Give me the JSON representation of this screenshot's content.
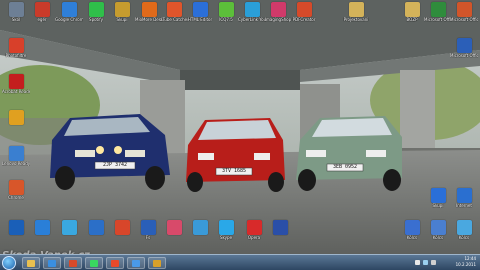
{
  "desktop_icons": [
    {
      "label": "Skól",
      "color": "#6d7f95",
      "icon": "computer-icon"
    },
    {
      "label": "egér",
      "color": "#c93b2a",
      "icon": "app-icon"
    },
    {
      "label": "Google Chrome",
      "color": "#2f7fd8",
      "icon": "chrome-icon"
    },
    {
      "label": "Spotify",
      "color": "#2fbf4a",
      "icon": "app-icon"
    },
    {
      "label": "Skupi",
      "color": "#c69c2e",
      "icon": "folder-icon"
    },
    {
      "label": "MioMore Desktop",
      "color": "#e06a1a",
      "icon": "app-icon"
    },
    {
      "label": "aTube Catcher",
      "color": "#e0552b",
      "icon": "app-icon"
    },
    {
      "label": "HTML Editor",
      "color": "#2b6fd8",
      "icon": "app-icon"
    },
    {
      "label": "ICQ7.5",
      "color": "#5cbf3a",
      "icon": "icq-icon"
    },
    {
      "label": "CyberLink YouCam",
      "color": "#2a9fd8",
      "icon": "webcam-icon"
    },
    {
      "label": "ImagingShop",
      "color": "#d13a6a",
      "icon": "app-icon"
    },
    {
      "label": "PDFCreator",
      "color": "#d64a2a",
      "icon": "pdf-icon"
    },
    {
      "label": "Projektovani",
      "color": "#d4b35a",
      "icon": "folder-icon"
    },
    {
      "label": "BOZP",
      "color": "#d4b35a",
      "icon": "folder-icon"
    },
    {
      "label": "Microsoft Office Ex...",
      "color": "#2f8c3c",
      "icon": "excel-icon"
    },
    {
      "label": "Microsoft Office P...",
      "color": "#d1552a",
      "icon": "powerpoint-icon"
    },
    {
      "label": "Photofiltre",
      "color": "#d8402a",
      "icon": "app-icon"
    },
    {
      "label": "Microsoft Office W...",
      "color": "#2b5fb8",
      "icon": "word-icon"
    },
    {
      "label": "Acrobat Reader",
      "color": "#c41e1e",
      "icon": "acrobat-icon"
    },
    {
      "label": "",
      "color": "#e0a020",
      "icon": "app-icon"
    },
    {
      "label": "Lenovo ReadyComm",
      "color": "#3a7fd0",
      "icon": "app-icon"
    },
    {
      "label": "Chrome",
      "color": "#d8562a",
      "icon": "app-icon"
    },
    {
      "label": "",
      "color": "#1a5fb8",
      "icon": "app-icon"
    },
    {
      "label": "",
      "color": "#2a7fd8",
      "icon": "app-icon"
    },
    {
      "label": "",
      "color": "#3aa8e0",
      "icon": "app-icon"
    },
    {
      "label": "",
      "color": "#2b6fc8",
      "icon": "app-icon"
    },
    {
      "label": "",
      "color": "#d8462a",
      "icon": "app-icon"
    },
    {
      "label": "Fs",
      "color": "#2a5fb8",
      "icon": "app-icon"
    },
    {
      "label": "",
      "color": "#d84a6a",
      "icon": "app-icon"
    },
    {
      "label": "",
      "color": "#3a9ad8",
      "icon": "app-icon"
    },
    {
      "label": "Skype",
      "color": "#2aa8e8",
      "icon": "skype-icon"
    },
    {
      "label": "Opera",
      "color": "#d82a2a",
      "icon": "opera-icon"
    },
    {
      "label": "",
      "color": "#2a4fa8",
      "icon": "app-icon"
    },
    {
      "label": "Kölcs",
      "color": "#3a6fd0",
      "icon": "app-icon"
    },
    {
      "label": "Kölcs",
      "color": "#4a7fd0",
      "icon": "app-icon"
    },
    {
      "label": "Internet",
      "color": "#2a6fd0",
      "icon": "app-icon"
    },
    {
      "label": "Kölcs",
      "color": "#4aa8e0",
      "icon": "app-icon"
    },
    {
      "label": "Skupi",
      "color": "#2a6fd8",
      "icon": "app-icon"
    }
  ],
  "plates": {
    "left": "2JP 3742",
    "middle": "3TV 1685",
    "right": "3EB 0952"
  },
  "watermark": "Skoda.Vanek.cz",
  "taskbar": {
    "clock_time": "12:44",
    "clock_date": "10.2.2011",
    "buttons": [
      {
        "name": "explorer",
        "color": "#e8c050"
      },
      {
        "name": "browser",
        "color": "#3a8fe0"
      },
      {
        "name": "app",
        "color": "#d84a2a"
      },
      {
        "name": "app",
        "color": "#3ad860"
      },
      {
        "name": "app",
        "color": "#e84a2a"
      },
      {
        "name": "app",
        "color": "#4a9ae8"
      },
      {
        "name": "app",
        "color": "#d8a02a"
      }
    ]
  }
}
